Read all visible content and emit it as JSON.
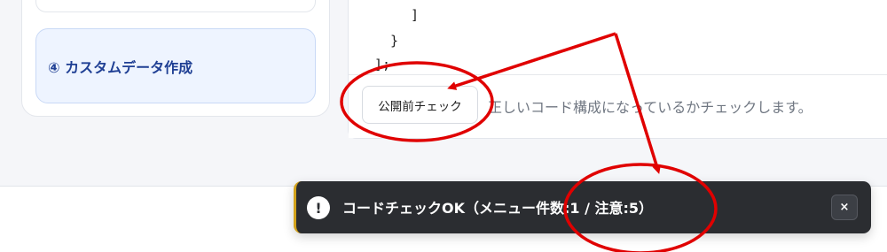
{
  "sidebar": {
    "active_step_label": "④ カスタムデータ作成"
  },
  "editor": {
    "code_lines": [
      "]",
      "}",
      "];"
    ],
    "precheck_button_label": "公開前チェック",
    "help_text": "正しいコード構成になっているかチェックします。"
  },
  "toast": {
    "icon_glyph": "!",
    "message": "コードチェックOK（メニュー件数:1 / 注意:5）",
    "close_label": "×",
    "accent_color": "#d3a21b"
  },
  "annotations": {
    "color": "#e00000"
  }
}
